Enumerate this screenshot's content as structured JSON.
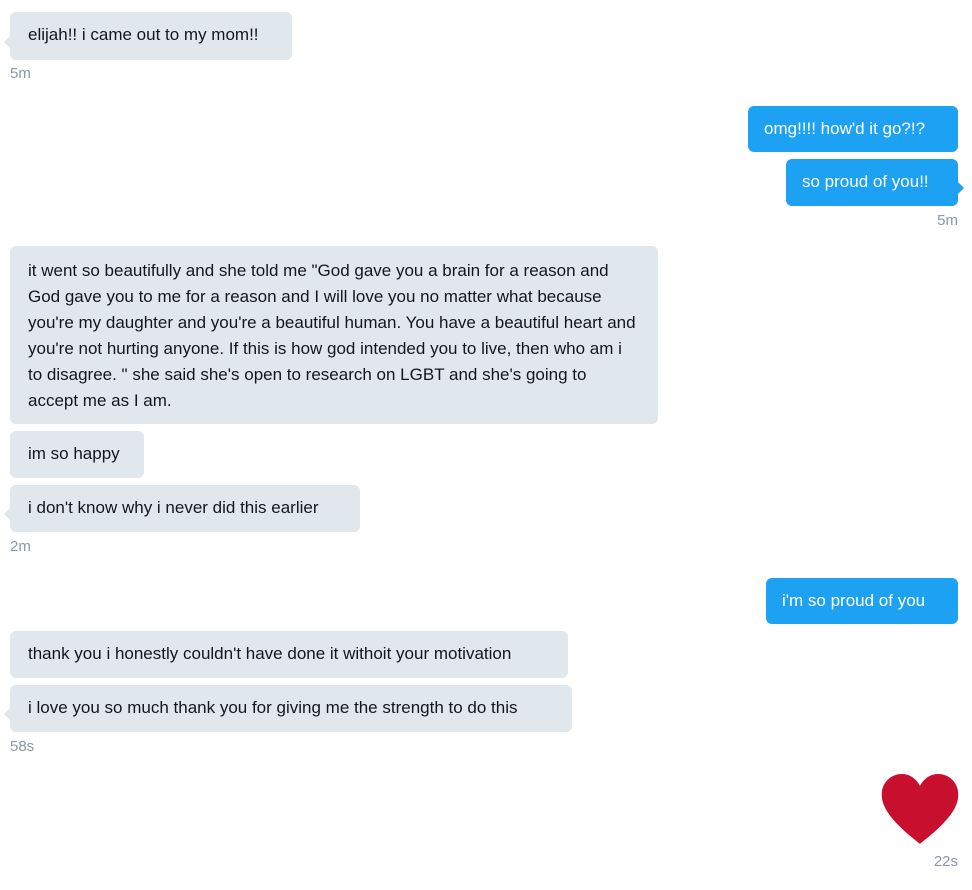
{
  "conversation": {
    "messages": [
      {
        "from": "them",
        "text": "elijah!! i came out to my mom!!"
      },
      {
        "from": "me",
        "text": "omg!!!! how'd it go?!?"
      },
      {
        "from": "me",
        "text": "so proud of you!!"
      },
      {
        "from": "them",
        "text": "it went so beautifully and she told me \"God gave you a brain for a reason and God gave you to me for a reason and I will love you no matter what because you're my daughter and you're a beautiful human. You have a beautiful heart and you're not hurting anyone. If this is how god intended you to live, then who am i to disagree. \" she said she's open to research on LGBT and she's going to accept me as I am."
      },
      {
        "from": "them",
        "text": "im so happy"
      },
      {
        "from": "them",
        "text": "i don't know why i never did this earlier"
      },
      {
        "from": "me",
        "text": "i'm so proud of you"
      },
      {
        "from": "them",
        "text": "thank you i honestly couldn't have done it withoit your motivation"
      },
      {
        "from": "them",
        "text": "i love you so much thank you for giving me the strength to do this"
      }
    ],
    "timestamps": {
      "t1": "5m",
      "t2": "5m",
      "t3": "2m",
      "t4": "58s",
      "t5": "22s"
    },
    "reaction": {
      "icon": "heart-icon",
      "color": "#c8102e"
    }
  },
  "colors": {
    "received_bubble": "#e1e8ed",
    "sent_bubble": "#1da1f2",
    "timestamp": "#8899a6"
  }
}
